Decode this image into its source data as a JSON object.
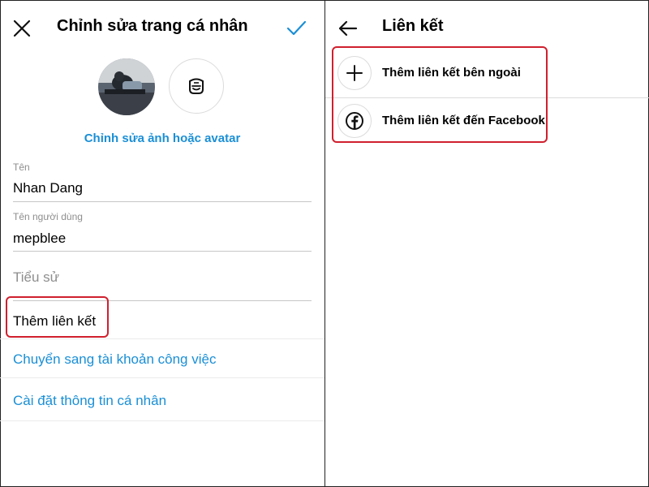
{
  "left_panel": {
    "header_title": "Chỉnh sửa trang cá nhân",
    "edit_photo_label": "Chỉnh sửa ảnh hoặc avatar",
    "fields": {
      "name_label": "Tên",
      "name_value": "Nhan Dang",
      "username_label": "Tên người dùng",
      "username_value": "mepblee",
      "bio_placeholder": "Tiểu sử"
    },
    "add_link": "Thêm liên kết",
    "switch_account": "Chuyển sang tài khoản công việc",
    "personal_info": "Cài đặt thông tin cá nhân"
  },
  "right_panel": {
    "header_title": "Liên kết",
    "items": [
      {
        "label": "Thêm liên kết bên ngoài",
        "icon": "plus-icon"
      },
      {
        "label": "Thêm liên kết đến Facebook",
        "icon": "facebook-icon"
      }
    ]
  },
  "colors": {
    "accent": "#1a8fd6",
    "highlight": "#d0202e"
  }
}
